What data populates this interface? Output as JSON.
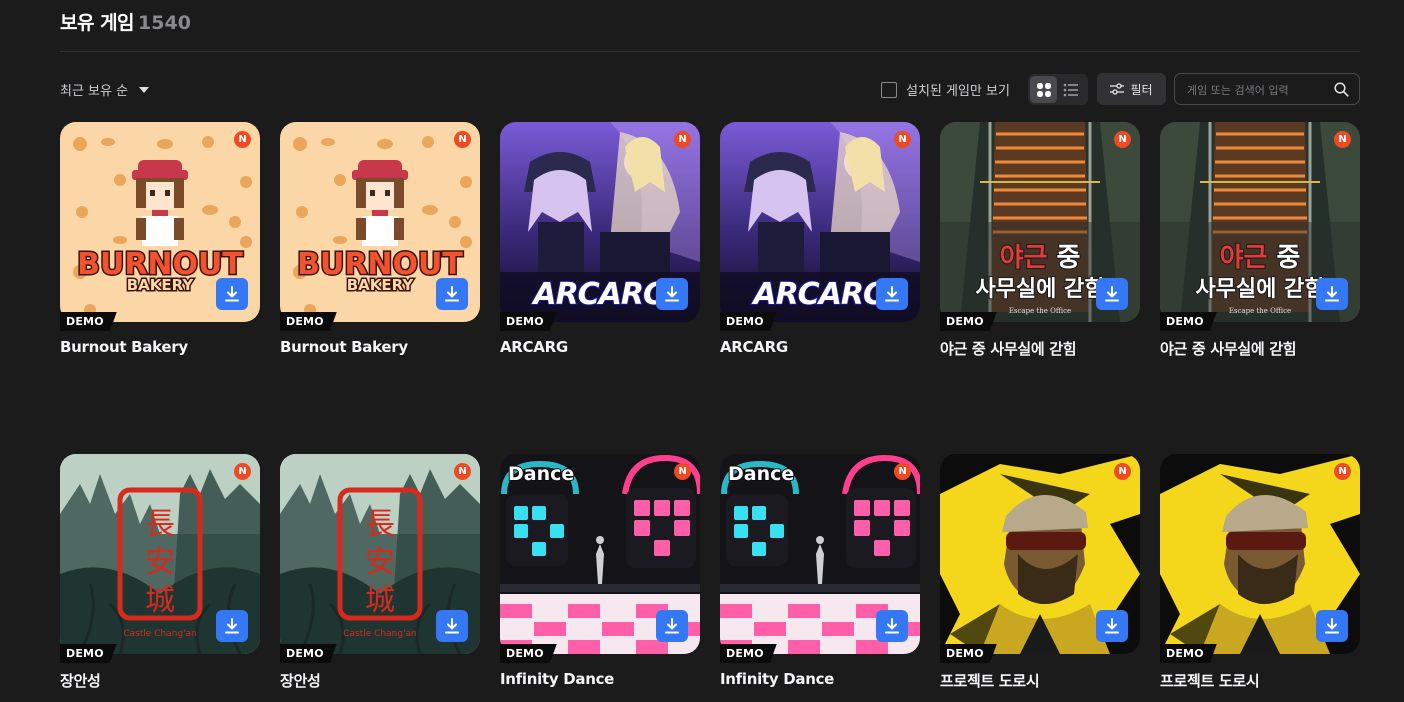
{
  "header": {
    "title": "보유 게임",
    "count": "1540"
  },
  "toolbar": {
    "sort_label": "최근 보유 순",
    "installed_only_label": "설치된 게임만 보기",
    "filter_label": "필터",
    "search_placeholder": "게임 또는 검색어 입력"
  },
  "badges": {
    "demo": "DEMO",
    "n": "N"
  },
  "colors": {
    "accent": "#3478f6",
    "badge": "#f04a23",
    "background": "#1b1b1c"
  },
  "games": [
    {
      "name": "Burnout Bakery",
      "art": "bakery"
    },
    {
      "name": "Burnout Bakery",
      "art": "bakery"
    },
    {
      "name": "ARCARG",
      "art": "arcarg"
    },
    {
      "name": "ARCARG",
      "art": "arcarg"
    },
    {
      "name": "야근 중 사무실에 갇힘",
      "art": "office"
    },
    {
      "name": "야근 중 사무실에 갇힘",
      "art": "office"
    },
    {
      "name": "장안성",
      "art": "changan"
    },
    {
      "name": "장안성",
      "art": "changan"
    },
    {
      "name": "Infinity Dance",
      "art": "dance"
    },
    {
      "name": "Infinity Dance",
      "art": "dance"
    },
    {
      "name": "프로젝트 도로시",
      "art": "dorothy"
    },
    {
      "name": "프로젝트 도로시",
      "art": "dorothy"
    }
  ],
  "art_text": {
    "bakery_title": "BURNOUT",
    "bakery_sub": "BAKERY",
    "arcarg_logo": "ARCARG",
    "office_line1a": "야근",
    "office_line1b": " 중",
    "office_line2": "사무실에 갇힘",
    "office_sub": "Escape the Office",
    "changan_c1": "長",
    "changan_c2": "安",
    "changan_c3": "城",
    "changan_sub": "Castle Chang'an",
    "dance_logo": "Dance"
  }
}
